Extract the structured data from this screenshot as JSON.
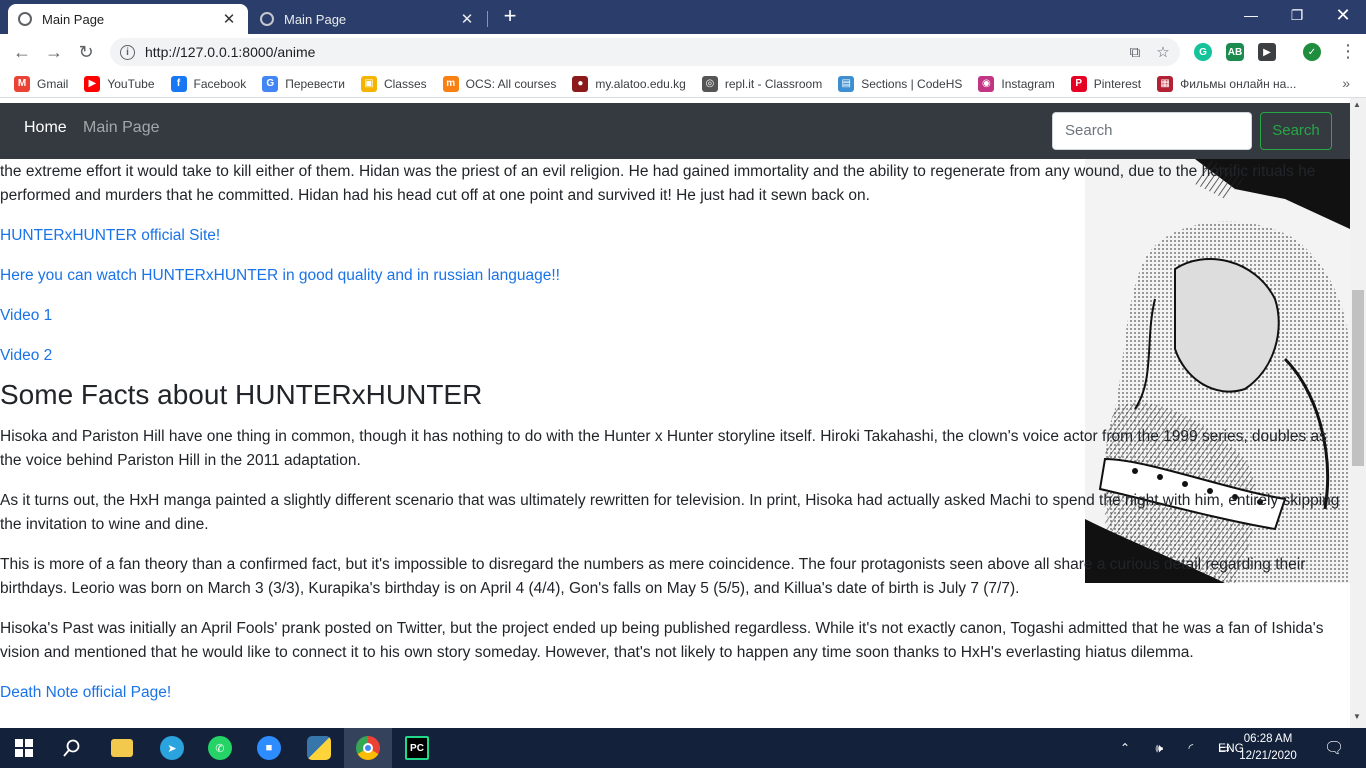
{
  "browser": {
    "tabs": [
      {
        "title": "Main Page",
        "active": true
      },
      {
        "title": "Main Page",
        "active": false
      }
    ],
    "url": "http://127.0.0.1:8000/anime",
    "bookmarks": [
      {
        "label": "Gmail",
        "icon": "gmail-icon",
        "color": "#ea4335",
        "glyph": "M"
      },
      {
        "label": "YouTube",
        "icon": "youtube-icon",
        "color": "#ff0000",
        "glyph": "▶"
      },
      {
        "label": "Facebook",
        "icon": "facebook-icon",
        "color": "#1877f2",
        "glyph": "f"
      },
      {
        "label": "Перевести",
        "icon": "translate-icon",
        "color": "#4285f4",
        "glyph": "G"
      },
      {
        "label": "Classes",
        "icon": "classroom-icon",
        "color": "#f4b400",
        "glyph": "▣"
      },
      {
        "label": "OCS: All courses",
        "icon": "moodle-icon",
        "color": "#f98012",
        "glyph": "m"
      },
      {
        "label": "my.alatoo.edu.kg",
        "icon": "alatoo-icon",
        "color": "#8b1a1a",
        "glyph": "●"
      },
      {
        "label": "repl.it - Classroom",
        "icon": "replit-icon",
        "color": "#555555",
        "glyph": "◎"
      },
      {
        "label": "Sections | CodeHS",
        "icon": "codehs-icon",
        "color": "#3d8fd1",
        "glyph": "▤"
      },
      {
        "label": "Instagram",
        "icon": "instagram-icon",
        "color": "#c13584",
        "glyph": "◉"
      },
      {
        "label": "Pinterest",
        "icon": "pinterest-icon",
        "color": "#e60023",
        "glyph": "P"
      },
      {
        "label": "Фильмы онлайн на...",
        "icon": "flag-icon",
        "color": "#b22234",
        "glyph": "▦"
      }
    ]
  },
  "navbar": {
    "brand": "Home",
    "link": "Main Page",
    "search_placeholder": "Search",
    "search_button": "Search"
  },
  "page": {
    "intro": "the extreme effort it would take to kill either of them. Hidan was the priest of an evil religion. He had gained immortality and the ability to regenerate from any wound, due to the horrific rituals he performed and murders that he committed. Hidan had his head cut off at one point and survived it! He just had it sewn back on.",
    "links": [
      "HUNTERxHUNTER official Site!",
      "Here you can watch HUNTERxHUNTER in good quality and in russian language!!",
      "Video 1",
      "Video 2"
    ],
    "heading": "Some Facts about HUNTERxHUNTER",
    "facts": [
      "Hisoka and Pariston Hill have one thing in common, though it has nothing to do with the Hunter x Hunter storyline itself. Hiroki Takahashi, the clown's voice actor from the 1999 series, doubles as the voice behind Pariston Hill in the 2011 adaptation.",
      "As it turns out, the HxH manga painted a slightly different scenario that was ultimately rewritten for television. In print, Hisoka had actually asked Machi to spend the night with him, entirely skipping the invitation to wine and dine.",
      "This is more of a fan theory than a confirmed fact, but it's impossible to disregard the numbers as mere coincidence. The four protagonists seen above all share a curious detail regarding their birthdays. Leorio was born on March 3 (3/3), Kurapika's birthday is on April 4 (4/4), Gon's falls on May 5 (5/5), and Killua's date of birth is July 7 (7/7).",
      "Hisoka's Past was initially an April Fools' prank posted on Twitter, but the project ended up being published regardless. While it's not exactly canon, Togashi admitted that he was a fan of Ishida's vision and mentioned that he would like to connect it to his own story someday. However, that's not likely to happen any time soon thanks to HxH's everlasting hiatus dilemma."
    ],
    "last_link": "Death Note official Page!"
  },
  "taskbar": {
    "apps": [
      "start-icon",
      "search-icon",
      "file-explorer-icon",
      "telegram-icon",
      "whatsapp-icon",
      "zoom-icon",
      "python-icon",
      "chrome-icon",
      "pycharm-icon"
    ],
    "language": "ENG",
    "time": "06:28 AM",
    "date": "12/21/2020"
  }
}
